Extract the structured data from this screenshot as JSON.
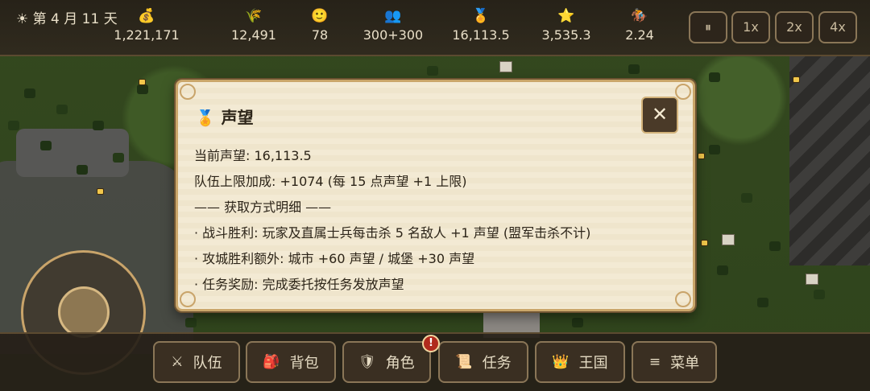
{
  "hud": {
    "day_text": "☀ 第 4 月 11 天",
    "stats": [
      {
        "icon": "money-bag-icon",
        "glyph": "💰",
        "value": "1,221,171",
        "color": "#d9a53c"
      },
      {
        "icon": "wheat-icon",
        "glyph": "🌾",
        "value": "12,491",
        "color": "#d8b043"
      },
      {
        "icon": "smile-icon",
        "glyph": "🙂",
        "value": "78",
        "color": "#e6c24a"
      },
      {
        "icon": "people-icon",
        "glyph": "👥",
        "value": "300+300",
        "color": "#6aa0d8"
      },
      {
        "icon": "medal-icon",
        "glyph": "🏅",
        "value": "16,113.5",
        "color": "#e2a337"
      },
      {
        "icon": "star-icon",
        "glyph": "⭐",
        "value": "3,535.3",
        "color": "#f0c53b"
      },
      {
        "icon": "horse-rider-icon",
        "glyph": "🏇",
        "value": "2.24",
        "color": "#d06a3a"
      }
    ],
    "speed_buttons": [
      "⏸",
      "1x",
      "2x",
      "4x"
    ]
  },
  "dialog": {
    "icon_glyph": "🏅",
    "title": "声望",
    "close_glyph": "✕",
    "lines": [
      "当前声望: 16,113.5",
      "队伍上限加成: +1074 (每 15 点声望 +1 上限)",
      "—— 获取方式明细 ——",
      "· 战斗胜利: 玩家及直属士兵每击杀 5 名敌人 +1 声望 (盟军击杀不计)",
      "· 攻城胜利额外: 城市 +60 声望 / 城堡 +30 声望",
      "· 任务奖励: 完成委托按任务发放声望"
    ]
  },
  "bottom_nav": [
    {
      "name": "party",
      "glyph": "⚔",
      "label": "队伍"
    },
    {
      "name": "backpack",
      "glyph": "🎒",
      "label": "背包"
    },
    {
      "name": "character",
      "glyph": "🛡",
      "label": "角色"
    },
    {
      "name": "quests",
      "glyph": "📜",
      "label": "任务"
    },
    {
      "name": "kingdom",
      "glyph": "👑",
      "label": "王国"
    },
    {
      "name": "menu",
      "glyph": "≡",
      "label": "菜单"
    }
  ],
  "notification_badge": "!"
}
